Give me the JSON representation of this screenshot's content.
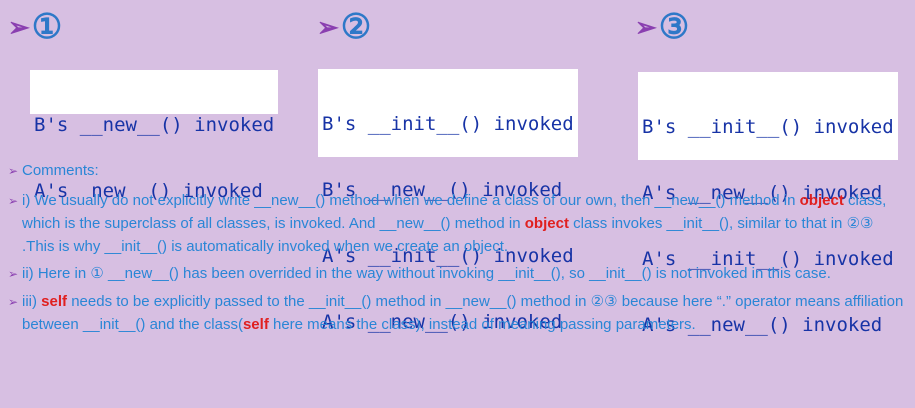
{
  "headers": [
    {
      "arrow": "➢",
      "num": "①"
    },
    {
      "arrow": "➢",
      "num": "②"
    },
    {
      "arrow": "➢",
      "num": "③"
    }
  ],
  "outputs": [
    [
      "B's __new__() invoked",
      "A's  new  () invoked"
    ],
    [
      "B's __init__() invoked",
      "B's __new__() invoked",
      "A's __init__() invoked",
      "A's __new__() invoked"
    ],
    [
      "B's __init__() invoked",
      "A's __new__() invoked",
      "A's __init__() invoked",
      "A's __new__() invoked"
    ]
  ],
  "comments": {
    "bullet": "➢",
    "heading": "Comments:",
    "item1": {
      "part1": "i) We usually do not explicitly write __new__() method when we define a class of our own, then __new__() method in ",
      "kw1": "object",
      "part2": " class, which is the superclass of all classes, is invoked. And __new__() method in ",
      "kw2": "object",
      "part3": " class invokes __init__(), similar to that in ②③ .This is why __init__() is automatically invoked when we create an object."
    },
    "item2": "ii) Here in ① __new__() has been overrided in the way without invoking __init__(), so __init__() is not invoked in this case.",
    "item3": {
      "part1": "iii) ",
      "kw1": "self",
      "part2": " needs to be explicitly passed to the __init__() method in __new__() method in ②③ because here “.” operator means affiliation between __init__() and the class(",
      "kw2": "self",
      "part3": " here means the class), instead of meaning passing parameters."
    }
  },
  "colors": {
    "background": "#d7bfe2",
    "arrow": "#8a3fb0",
    "number": "#2e78c8",
    "code": "#1733a6",
    "comment_text": "#2a86d6",
    "keyword": "#e0201f"
  }
}
